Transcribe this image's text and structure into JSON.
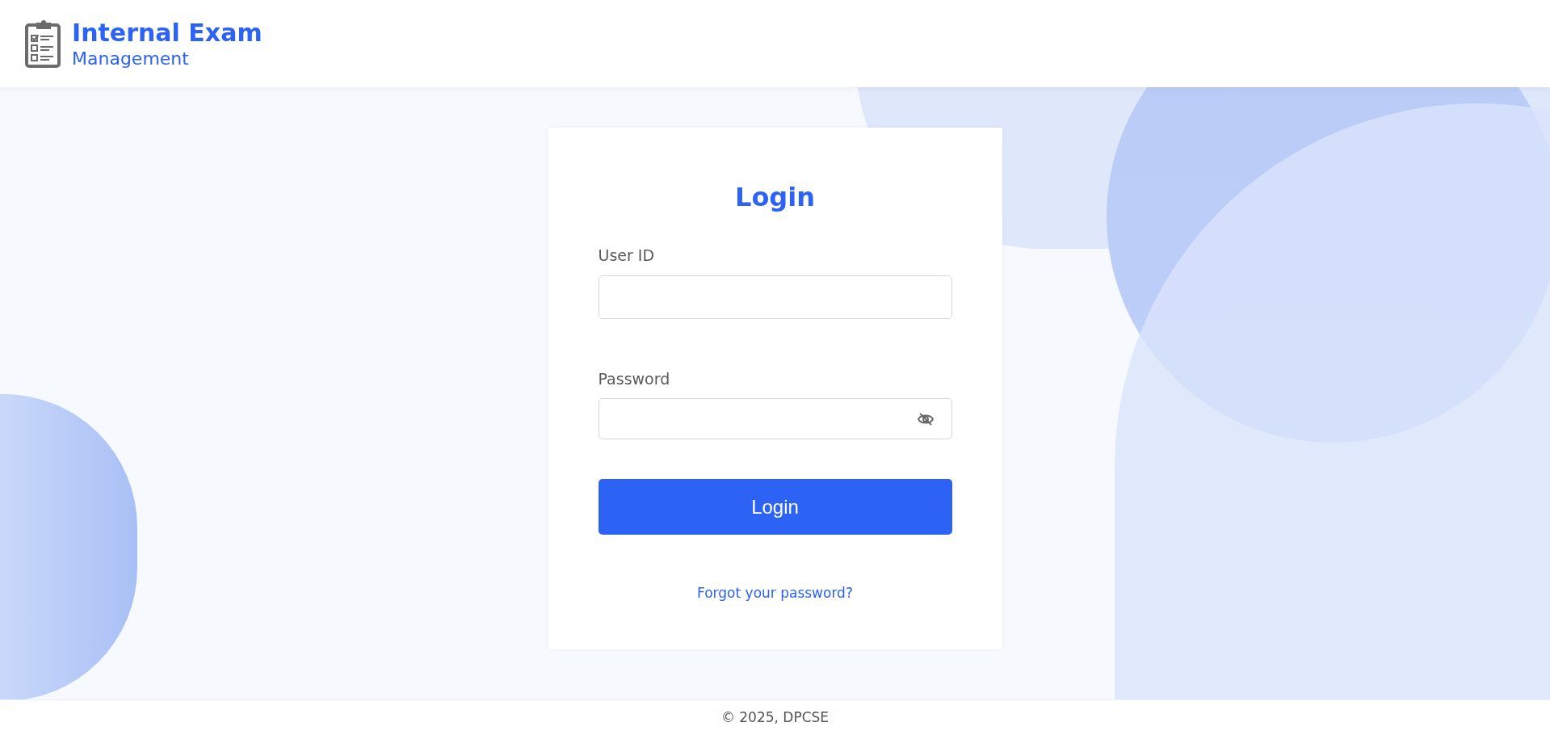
{
  "header": {
    "title": "Internal Exam",
    "subtitle": "Management"
  },
  "login": {
    "title": "Login",
    "fields": [
      {
        "kind": "text",
        "label": "User ID"
      },
      {
        "kind": "password",
        "label": "Password"
      }
    ],
    "button": "Login",
    "link": "Forgot your password?"
  },
  "footer": "© 2025, DPCSE"
}
